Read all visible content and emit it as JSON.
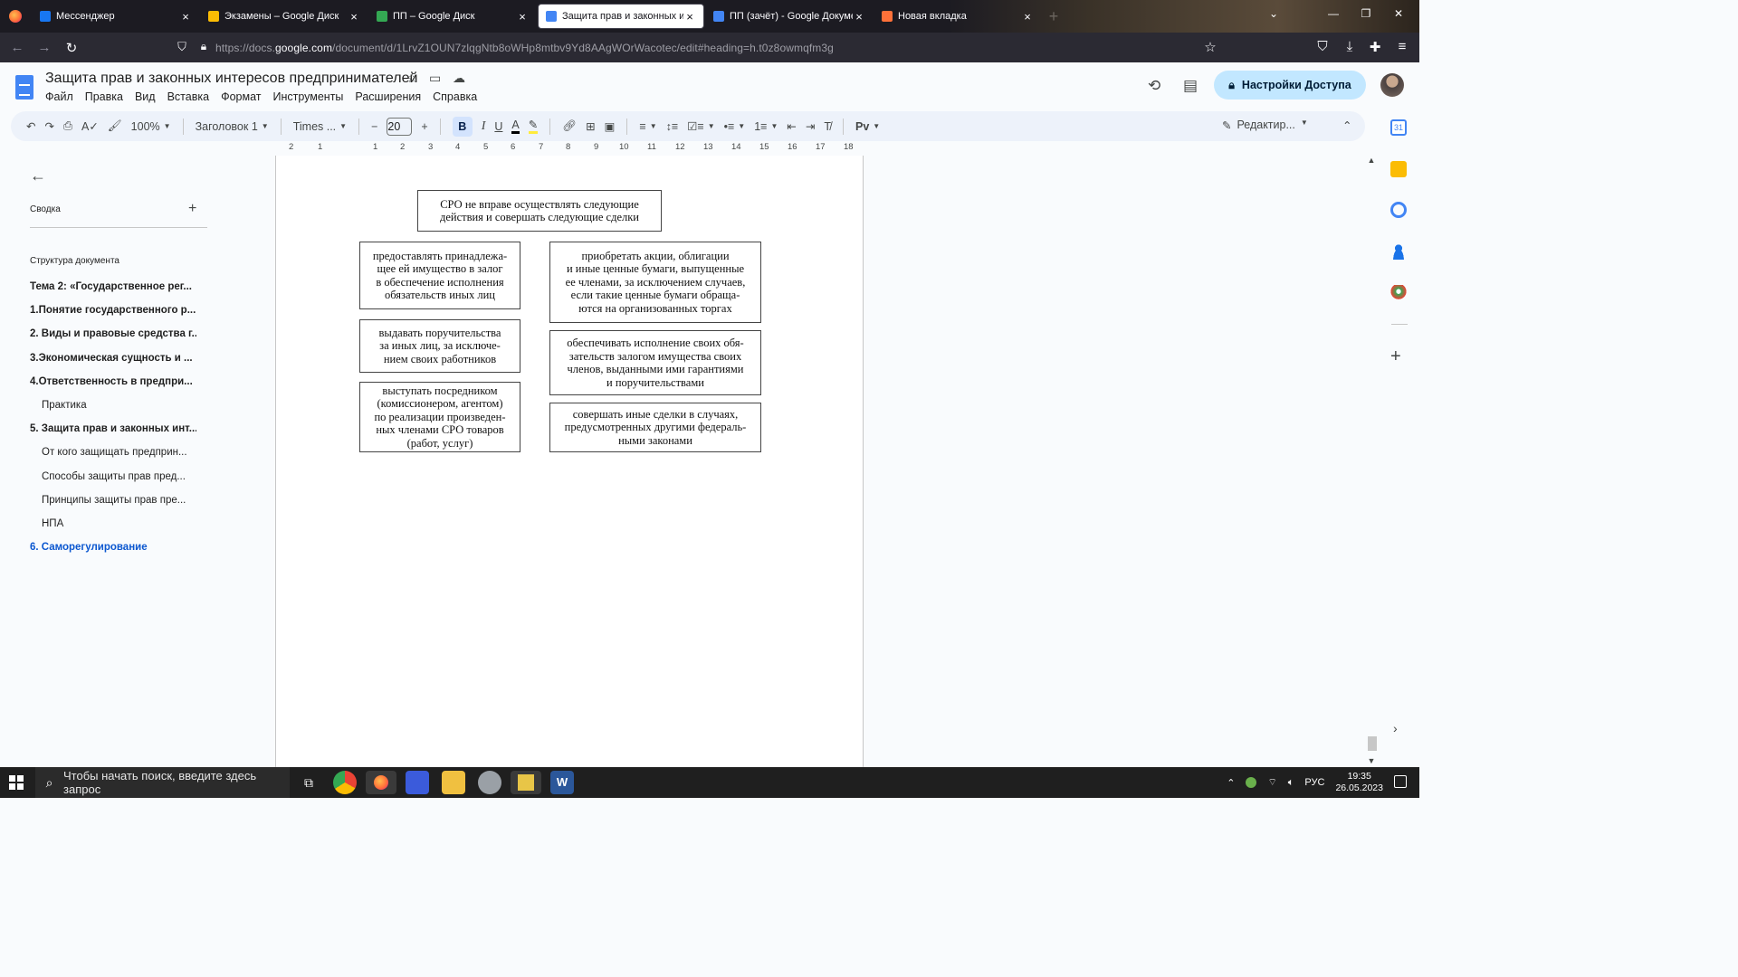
{
  "browser": {
    "tabs": [
      {
        "label": "Мессенджер",
        "icon": "messenger-icon",
        "color": "#1877f2",
        "active": false
      },
      {
        "label": "Экзамены – Google Диск",
        "icon": "google-drive-icon",
        "color": "#fbbc04",
        "active": false
      },
      {
        "label": "ПП – Google Диск",
        "icon": "google-drive-icon",
        "color": "#34a853",
        "active": false
      },
      {
        "label": "Защита прав и законных инте",
        "icon": "google-docs-icon",
        "color": "#4285f4",
        "active": true
      },
      {
        "label": "ПП (зачёт) - Google Документ",
        "icon": "google-docs-icon",
        "color": "#4285f4",
        "active": false
      },
      {
        "label": "Новая вкладка",
        "icon": "firefox-icon",
        "color": "#ff7139",
        "active": false
      }
    ],
    "url_prefix": "https://docs.",
    "url_domain": "google.com",
    "url_path": "/document/d/1LrvZ1OUN7zlqgNtb8oWHp8mtbv9Yd8AAgWOrWacotec/edit#heading=h.t0z8owmqfm3g"
  },
  "docs": {
    "title": "Защита прав и законных интересов предпринимателей",
    "menu": [
      "Файл",
      "Правка",
      "Вид",
      "Вставка",
      "Формат",
      "Инструменты",
      "Расширения",
      "Справка"
    ],
    "share_label": "Настройки Доступа"
  },
  "toolbar": {
    "zoom": "100%",
    "style": "Заголовок 1",
    "font": "Times ...",
    "font_size": "20",
    "mode": "Редактир..."
  },
  "ruler": [
    "2",
    "1",
    "1",
    "2",
    "3",
    "4",
    "5",
    "6",
    "7",
    "8",
    "9",
    "10",
    "11",
    "12",
    "13",
    "14",
    "15",
    "16",
    "17",
    "18"
  ],
  "outline": {
    "summary_label": "Сводка",
    "structure_label": "Структура документа",
    "items": [
      {
        "text": "Тема 2: «Государственное рег...",
        "level": 1
      },
      {
        "text": "1.Понятие государственного р...",
        "level": 1
      },
      {
        "text": "2. Виды и правовые средства г...",
        "level": 1
      },
      {
        "text": "3.Экономическая сущность и ...",
        "level": 1
      },
      {
        "text": "4.Ответственность в предпри...",
        "level": 1
      },
      {
        "text": "Практика",
        "level": 2
      },
      {
        "text": "5. Защита прав и законных инт...",
        "level": 1
      },
      {
        "text": "От кого защищать предприн...",
        "level": 2
      },
      {
        "text": "Способы защиты прав пред...",
        "level": 2
      },
      {
        "text": "Принципы защиты прав пре...",
        "level": 2
      },
      {
        "text": "НПА",
        "level": 2
      },
      {
        "text": "6. Саморегулирование",
        "level": 1,
        "active": true
      }
    ]
  },
  "diagram": {
    "top": "СРО не вправе осуществлять следующие\nдействия и совершать следующие сделки",
    "left": [
      "предоставлять принадлежа-\nщее ей имущество в залог\nв обеспечение исполнения\nобязательств иных лиц",
      "выдавать поручительства\nза иных лиц, за исключе-\nнием своих работников",
      "выступать посредником\n(комиссионером, агентом)\nпо реализации произведен-\nных членами СРО товаров\n(работ, услуг)"
    ],
    "right": [
      "приобретать акции, облигации\nи иные ценные бумаги, выпущенные\nее членами, за исключением случаев,\nесли такие ценные бумаги обраща-\nются на организованных торгах",
      "обеспечивать исполнение своих обя-\nзательств залогом имущества своих\nчленов, выданными ими гарантиями\nи поручительствами",
      "совершать иные сделки в случаях,\nпредусмотренных другими федераль-\nными законами"
    ]
  },
  "taskbar": {
    "search_placeholder": "Чтобы начать поиск, введите здесь запрос",
    "lang": "РУС",
    "time": "19:35",
    "date": "26.05.2023"
  }
}
